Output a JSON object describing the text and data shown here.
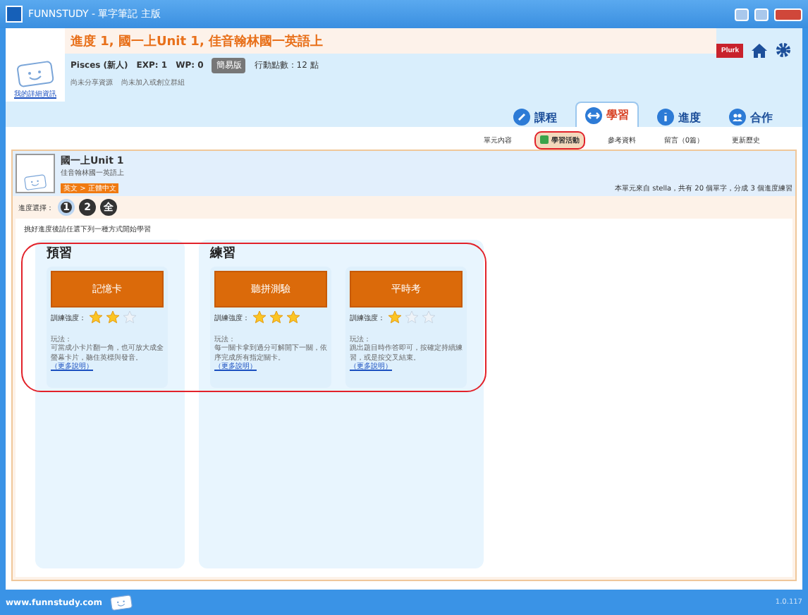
{
  "window": {
    "title": "FUNNSTUDY - 單字筆記 主版"
  },
  "header": {
    "headline": "進度 1, 國一上Unit 1, 佳音翰林國一英語上",
    "user": "Pisces (新人)",
    "exp": "EXP: 1",
    "wp": "WP: 0",
    "edition": "簡易版",
    "points": "行動點數：12 點",
    "share": "尚未分享資源",
    "group": "尚未加入或創立群組",
    "profile_link": "我的詳細資訊",
    "plurk": "Plurk"
  },
  "tabs": [
    {
      "label": "課程",
      "selected": false
    },
    {
      "label": "學習",
      "selected": true
    },
    {
      "label": "進度",
      "selected": false
    },
    {
      "label": "合作",
      "selected": false
    }
  ],
  "sub_tabs": [
    {
      "label": "單元內容",
      "selected": false,
      "highlighted": false
    },
    {
      "label": "學習活動",
      "selected": true,
      "highlighted": true
    },
    {
      "label": "參考資料",
      "selected": false,
      "highlighted": false
    },
    {
      "label": "留言（0篇）",
      "selected": false,
      "highlighted": false
    },
    {
      "label": "更新歷史",
      "selected": false,
      "highlighted": false
    }
  ],
  "unit": {
    "title": "國一上Unit 1",
    "book": "佳音翰林國一英語上",
    "language": "英文 > 正體中文",
    "summary": "本單元來自 stella，共有 20 個單字，分成 3 個進度練習"
  },
  "progress": {
    "label": "進度選擇：",
    "options": [
      {
        "label": "1",
        "selected": true
      },
      {
        "label": "2",
        "selected": false
      },
      {
        "label": "全",
        "selected": false
      }
    ]
  },
  "instruction": "挑好進度後請任選下列一種方式開始學習",
  "activities_highlighted": true,
  "groups": [
    {
      "title": "預習",
      "cards": [
        {
          "button": "記憶卡",
          "intensity": "訓練強度：",
          "stars": 2,
          "how": "玩法：",
          "description": "可當成小卡片翻一角，也可放大成全螢幕卡片，聽住英標與發音。",
          "more": "（更多說明）"
        }
      ]
    },
    {
      "title": "練習",
      "cards": [
        {
          "button": "聽拼測驗",
          "intensity": "訓練強度：",
          "stars": 3,
          "how": "玩法：",
          "description": "每一關卡拿到過分可解開下一關，依序完成所有指定關卡。",
          "more": "（更多說明）"
        },
        {
          "button": "平時考",
          "intensity": "訓練強度：",
          "stars": 1,
          "how": "玩法：",
          "description": "跳出題目時作答即可，按確定持續練習，或是按交叉結束。",
          "more": "（更多說明）"
        }
      ]
    }
  ],
  "footer": {
    "site": "www.funnstudy.com",
    "version": "1.0.117"
  }
}
